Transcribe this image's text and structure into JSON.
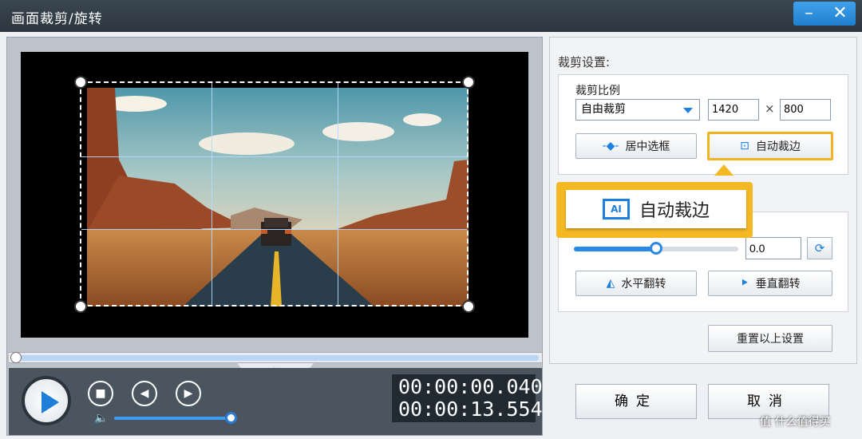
{
  "window": {
    "title": "画面裁剪/旋转",
    "minimize_icon": "minimize-icon",
    "close_icon": "close-icon"
  },
  "player": {
    "current_time": "00:00:00.040",
    "total_time": "00:00:13.554",
    "volume_level": 1.0,
    "seek_position": 0.0
  },
  "crop": {
    "section_label": "裁剪设置:",
    "ratio_label": "裁剪比例",
    "ratio_value": "自由裁剪",
    "width": "1420",
    "times_sign": "×",
    "height": "800",
    "center_btn": "居中选框",
    "auto_btn": "自动裁边"
  },
  "callout": {
    "label": "自动裁边",
    "icon_text": "AI"
  },
  "rotate": {
    "angle": "0.0",
    "slider_value": 0.5,
    "flip_h": "水平翻转",
    "flip_v": "垂直翻转"
  },
  "reset_btn": "重置以上设置",
  "footer": {
    "ok": "确定",
    "cancel": "取消"
  },
  "watermark": "值 什么值得买",
  "colors": {
    "accent": "#1d7fe0",
    "highlight": "#f4b824"
  }
}
